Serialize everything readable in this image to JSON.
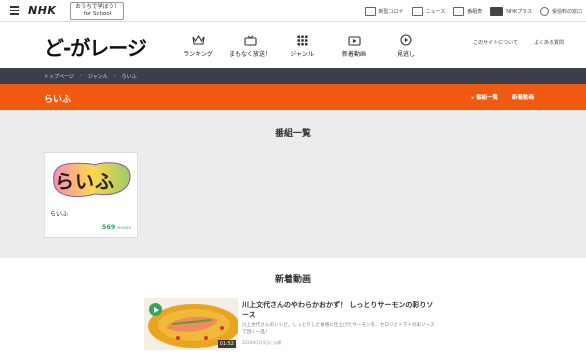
{
  "nhk_bar": {
    "logo": "NHK",
    "school_line1": "おうちで学ぼう！",
    "school_line2": "for School",
    "links": [
      {
        "label": "新型コロナ",
        "icon": "virus-icon"
      },
      {
        "label": "ニュース",
        "icon": "news-icon"
      },
      {
        "label": "番組表",
        "icon": "schedule-icon"
      },
      {
        "label": "NHKプラス",
        "icon": "nhkplus-icon"
      },
      {
        "label": "受信料の窓口",
        "icon": "fee-icon"
      }
    ]
  },
  "header": {
    "logo": "ど-がレージ",
    "nav": [
      {
        "label": "ランキング",
        "icon": "crown-icon"
      },
      {
        "label": "まもなく放送！",
        "icon": "tv-icon"
      },
      {
        "label": "ジャンル",
        "icon": "grid-icon"
      },
      {
        "label": "新着動画",
        "icon": "new-video-icon"
      },
      {
        "label": "見逃し",
        "icon": "replay-icon"
      }
    ],
    "links": [
      "このサイトについて",
      "よくある質問"
    ]
  },
  "breadcrumb": [
    "トップページ",
    "ジャンル",
    "らいふ"
  ],
  "titlebar": {
    "title": "らいふ",
    "tabs": [
      "番組一覧",
      "新着動画"
    ]
  },
  "programs": {
    "heading": "番組一覧",
    "items": [
      {
        "name": "らいふ",
        "logo_text": "らいふ",
        "count": "569",
        "count_unit": "MOVIES"
      }
    ]
  },
  "new_videos": {
    "heading": "新着動画",
    "items": [
      {
        "title": "川上文代さんのやわらかおかず！ しっとりサーモンの彩りソース",
        "description": "川上文代さんのレシピ。しっとりした食感に仕上げたサーモンを、セロリとトマトの彩ソースで頂く一品！",
        "date": "2020年3月4日に公開",
        "duration": "01:52"
      }
    ]
  },
  "colors": {
    "accent_orange": "#f05a10",
    "breadcrumb_bg": "#3a3f4a",
    "green": "#3aa35a"
  }
}
